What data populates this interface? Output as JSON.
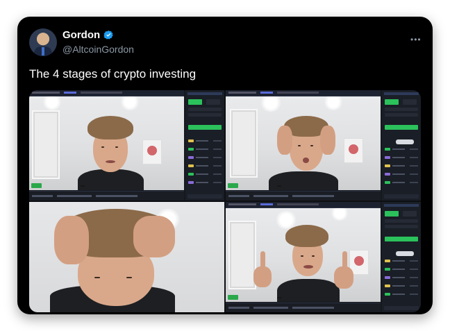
{
  "tweet": {
    "display_name": "Gordon",
    "handle": "@AltcoinGordon",
    "text": "The 4 stages of crypto investing",
    "verified": true,
    "more_icon": "•••"
  },
  "media": {
    "panels": [
      {
        "name": "stage-1-smiling"
      },
      {
        "name": "stage-2-hands-on-head"
      },
      {
        "name": "stage-3-head-down"
      },
      {
        "name": "stage-4-middle-fingers"
      }
    ]
  },
  "colors": {
    "card_bg": "#000000",
    "name": "#ffffff",
    "handle": "#8b98a5",
    "verified": "#1d9bf0",
    "buy_green": "#2bc15b"
  }
}
